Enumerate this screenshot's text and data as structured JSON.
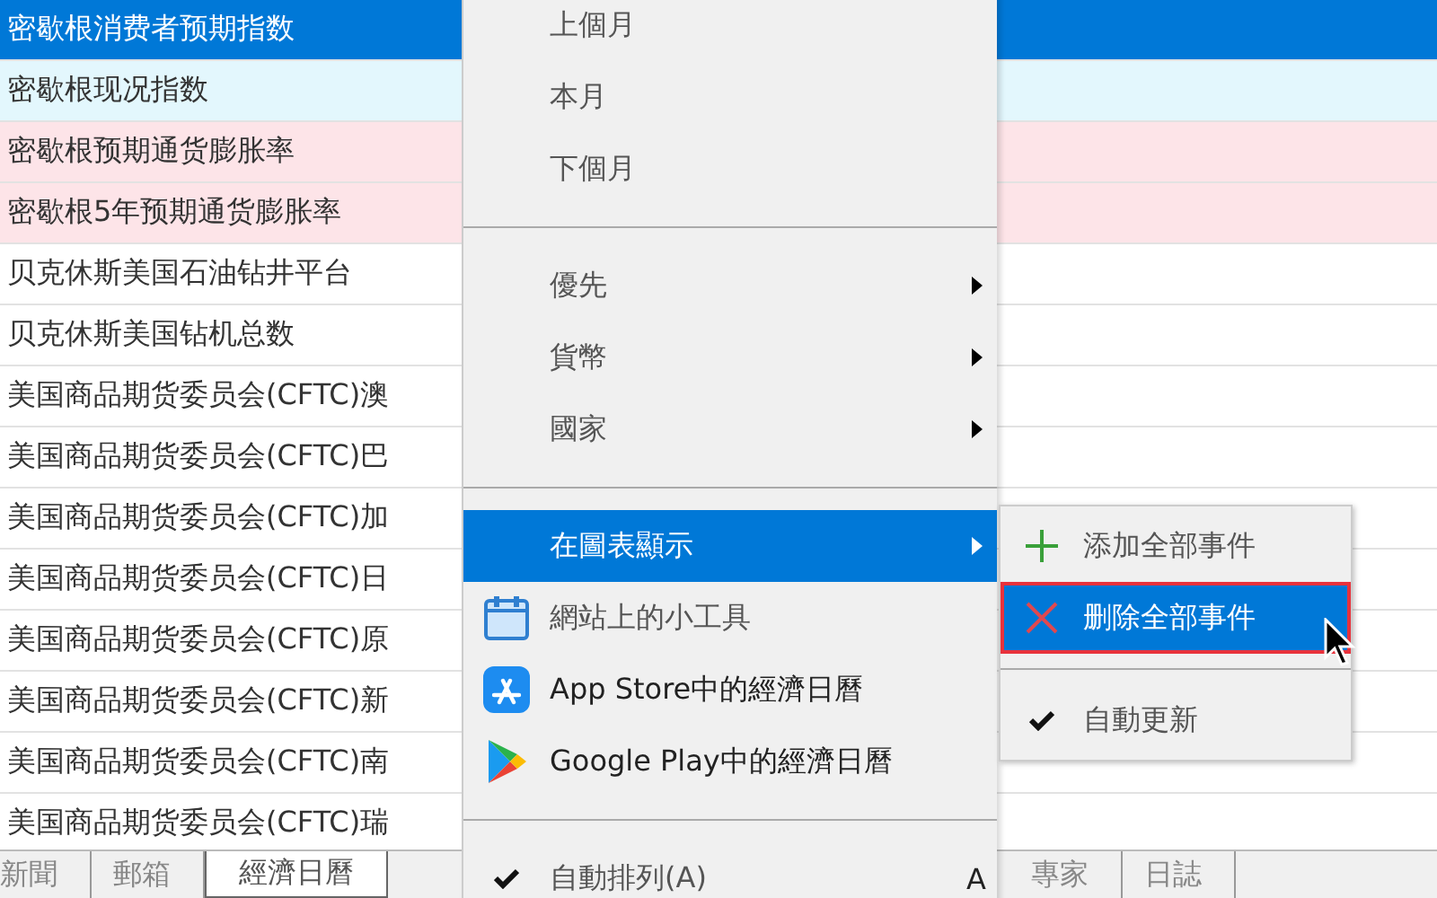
{
  "rows": [
    {
      "text": "密歇根消费者预期指数",
      "selected": true,
      "color": "#0078d7"
    },
    {
      "text": "密歇根现况指数",
      "selected": false,
      "color": "#e3f7fd"
    },
    {
      "text": "密歇根预期通货膨胀率",
      "selected": false,
      "color": "#fde4e8"
    },
    {
      "text": "密歇根5年预期通货膨胀率",
      "selected": false,
      "color": "#fde4e8"
    },
    {
      "text": "贝克休斯美国石油钻井平台",
      "selected": false,
      "color": "#ffffff"
    },
    {
      "text": "贝克休斯美国钻机总数",
      "selected": false,
      "color": "#ffffff"
    },
    {
      "text": "美国商品期货委员会(CFTC)澳",
      "selected": false,
      "color": "#ffffff"
    },
    {
      "text": "美国商品期货委员会(CFTC)巴",
      "selected": false,
      "color": "#ffffff"
    },
    {
      "text": "美国商品期货委员会(CFTC)加",
      "selected": false,
      "color": "#ffffff"
    },
    {
      "text": "美国商品期货委员会(CFTC)日",
      "selected": false,
      "color": "#ffffff"
    },
    {
      "text": "美国商品期货委员会(CFTC)原",
      "selected": false,
      "color": "#ffffff"
    },
    {
      "text": "美国商品期货委员会(CFTC)新",
      "selected": false,
      "color": "#ffffff"
    },
    {
      "text": "美国商品期货委员会(CFTC)南",
      "selected": false,
      "color": "#ffffff"
    },
    {
      "text": "美国商品期货委员会(CFTC)瑞",
      "selected": false,
      "color": "#ffffff"
    }
  ],
  "tabs": [
    {
      "label": "新聞",
      "selected": false
    },
    {
      "label": "郵箱",
      "selected": false
    },
    {
      "label": "經濟日曆",
      "selected": true
    },
    {
      "label": "專家",
      "selected": false
    },
    {
      "label": "日誌",
      "selected": false
    }
  ],
  "menu": [
    {
      "kind": "item",
      "label": "上個月",
      "selected": false
    },
    {
      "kind": "item",
      "label": "本月",
      "selected": false
    },
    {
      "kind": "item",
      "label": "下個月",
      "selected": false
    },
    {
      "kind": "separator"
    },
    {
      "kind": "submenu",
      "label": "優先",
      "selected": false
    },
    {
      "kind": "submenu",
      "label": "貨幣",
      "selected": false
    },
    {
      "kind": "submenu",
      "label": "國家",
      "selected": false
    },
    {
      "kind": "separator"
    },
    {
      "kind": "submenu",
      "label": "在圖表顯示",
      "selected": true
    },
    {
      "kind": "widget",
      "label": "網站上的小工具",
      "selected": false
    },
    {
      "kind": "appstore",
      "label": "App Store中的經濟日曆",
      "selected": false
    },
    {
      "kind": "playstore",
      "label": "Google Play中的經濟日曆",
      "selected": false
    },
    {
      "kind": "separator"
    },
    {
      "kind": "check",
      "label": "自動排列(A)",
      "checked": true,
      "shortcut": "A",
      "selected": false
    }
  ],
  "submenu": [
    {
      "kind": "add",
      "label": "添加全部事件",
      "selected": false
    },
    {
      "kind": "remove",
      "label": "删除全部事件",
      "selected": true
    },
    {
      "kind": "separator"
    },
    {
      "kind": "check",
      "label": "自動更新",
      "checked": true,
      "selected": false
    }
  ]
}
